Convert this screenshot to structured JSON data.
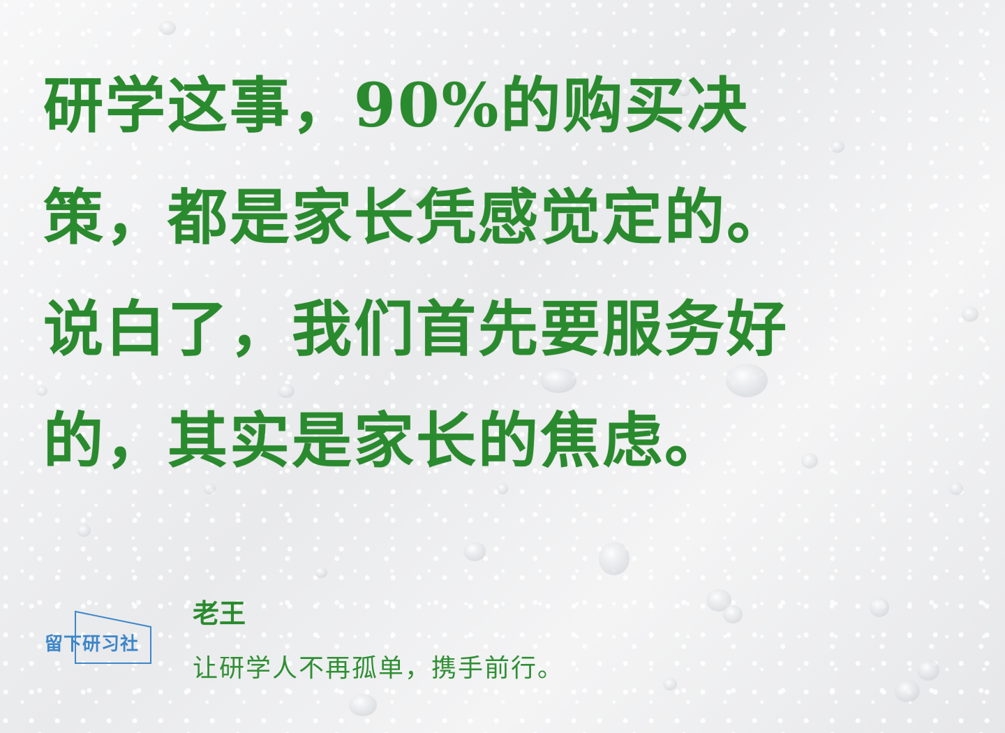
{
  "quote": {
    "lines": [
      "研学这事，90%的购买决",
      "策，都是家长凭感觉定的。",
      "说白了，我们首先要服务好",
      "的，其实是家长的焦虑。"
    ]
  },
  "logo": {
    "text": "留下研习社"
  },
  "author": {
    "name": "老王",
    "tagline": "让研学人不再孤单，携手前行。"
  },
  "colors": {
    "text_green": "#2a8a2e",
    "logo_blue": "#3d86c9",
    "background": "#f1f2f3"
  }
}
